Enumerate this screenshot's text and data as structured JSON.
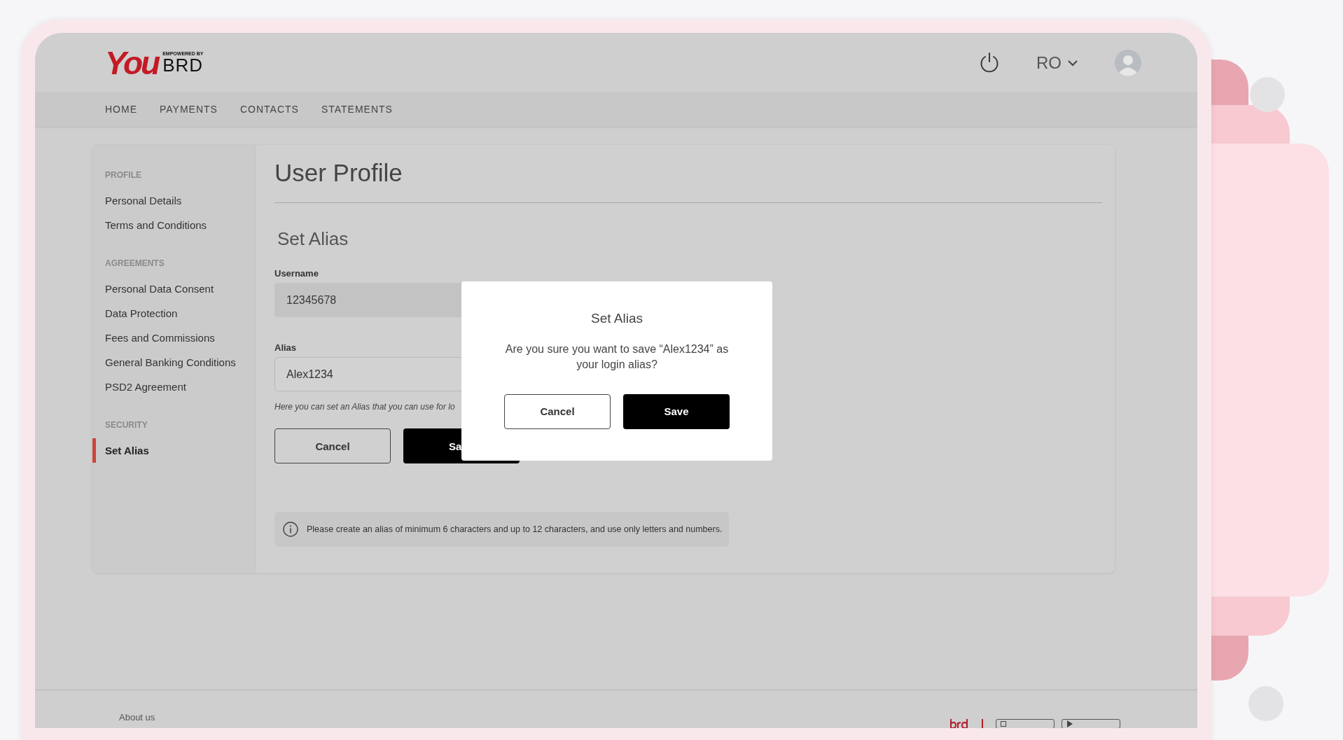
{
  "header": {
    "logo": {
      "wordmark": "You",
      "tagline": "EMPOWERED BY",
      "brand": "BRD"
    },
    "language": "RO"
  },
  "nav": [
    {
      "label": "HOME"
    },
    {
      "label": "PAYMENTS"
    },
    {
      "label": "CONTACTS"
    },
    {
      "label": "STATEMENTS"
    }
  ],
  "sidebar": {
    "sections": [
      {
        "heading": "PROFILE",
        "items": [
          {
            "label": "Personal Details",
            "selected": false
          },
          {
            "label": "Terms and Conditions",
            "selected": false
          }
        ]
      },
      {
        "heading": "AGREEMENTS",
        "items": [
          {
            "label": "Personal Data Consent",
            "selected": false
          },
          {
            "label": "Data Protection",
            "selected": false
          },
          {
            "label": "Fees and Commissions",
            "selected": false
          },
          {
            "label": "General Banking Conditions",
            "selected": false
          },
          {
            "label": "PSD2 Agreement",
            "selected": false
          }
        ]
      },
      {
        "heading": "SECURITY",
        "items": [
          {
            "label": "Set Alias",
            "selected": true
          }
        ]
      }
    ]
  },
  "page": {
    "title": "User Profile",
    "section_title": "Set Alias",
    "fields": [
      {
        "label": "Username",
        "value": "12345678",
        "disabled": true
      },
      {
        "label": "Alias",
        "value": "Alex1234",
        "disabled": false
      }
    ],
    "hint": "Here you can set an Alias that you can use for lo",
    "buttons": [
      {
        "label": "Cancel",
        "kind": "secondary"
      },
      {
        "label": "Sa",
        "kind": "primary"
      }
    ],
    "info": "Please create an alias of minimum 6 characters and up to 12 characters, and use only letters and numbers."
  },
  "dialog": {
    "title": "Set Alias",
    "message": "Are you sure you want to save “Alex1234” as your login alias?",
    "buttons": [
      {
        "label": "Cancel",
        "kind": "secondary"
      },
      {
        "label": "Save",
        "kind": "primary"
      }
    ]
  },
  "footer": {
    "link": "About us"
  }
}
